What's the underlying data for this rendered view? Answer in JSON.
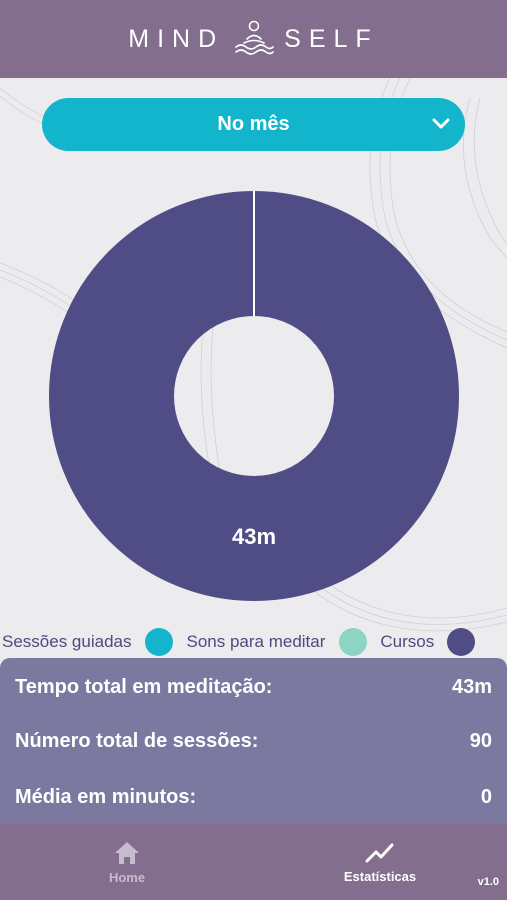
{
  "header": {
    "brand_left": "MIND",
    "brand_right": "SELF",
    "logo_icon": "meditation-figure-icon"
  },
  "period_select": {
    "selected": "No mês",
    "icon": "chevron-down-icon"
  },
  "chart_data": {
    "type": "pie",
    "style": "donut",
    "categories": [
      "Sessões guiadas",
      "Sons para meditar",
      "Cursos"
    ],
    "values": [
      0,
      0,
      43
    ],
    "unit": "m",
    "data_labels": [
      "",
      "",
      "43m"
    ],
    "colors": [
      "#12b5cb",
      "#8cd4c4",
      "#504c85"
    ]
  },
  "legend": [
    {
      "label": "Sessões guiadas",
      "color": "#12b5cb"
    },
    {
      "label": "Sons para meditar",
      "color": "#8cd4c4"
    },
    {
      "label": "Cursos",
      "color": "#504c85"
    }
  ],
  "stats": [
    {
      "label": "Tempo total em meditação:",
      "value": "43m"
    },
    {
      "label": "Número total de sessões:",
      "value": "90"
    },
    {
      "label": "Média em minutos:",
      "value": "0"
    }
  ],
  "bottom_nav": {
    "items": [
      {
        "label": "Home",
        "icon": "home-icon",
        "active": false
      },
      {
        "label": "Estatísticas",
        "icon": "trending-up-icon",
        "active": true
      }
    ],
    "version": "v1.0"
  },
  "colors": {
    "header_bg": "#836f8d",
    "accent": "#12b5cb",
    "panel_bg": "#7c79a1",
    "chart_fill": "#504c85",
    "inactive_nav": "#c7bccd"
  }
}
